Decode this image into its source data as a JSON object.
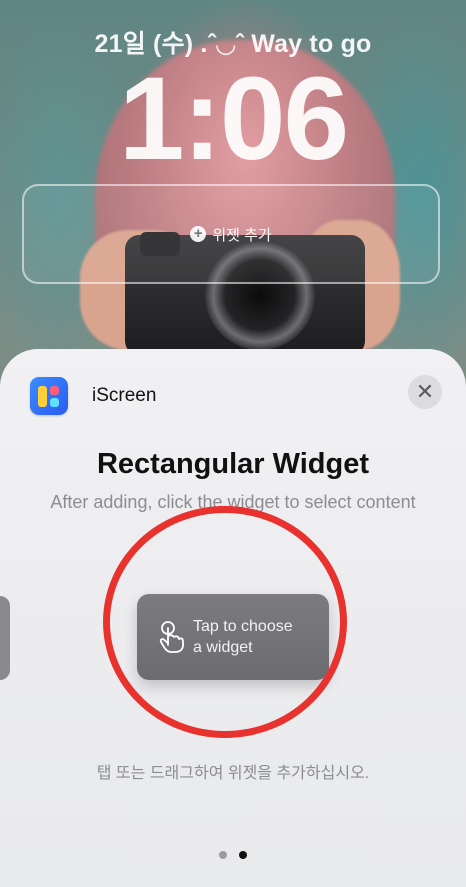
{
  "lock_screen": {
    "date_line": "21일 (수)  .ˆ◡ˆ Way to go",
    "time": "1:06",
    "add_widget_label": "위젯 추가",
    "add_widget_icon": "plus-circle-icon"
  },
  "sheet": {
    "app_name": "iScreen",
    "app_icon": "iscreen-app-icon",
    "close_icon": "close-icon",
    "close_glyph": "✕",
    "title": "Rectangular Widget",
    "subtitle": "After adding, click the widget to select content",
    "widget_card": {
      "line1": "Tap to choose",
      "line2": "a widget",
      "icon": "tap-hand-icon"
    },
    "hint": "탭 또는 드래그하여 위젯을 추가하십시오.",
    "pagination": {
      "pages": 2,
      "current": 2
    }
  },
  "colors": {
    "annotation_circle": "#e8322e",
    "sheet_background": "#efeff1",
    "widget_card": "#747478"
  }
}
